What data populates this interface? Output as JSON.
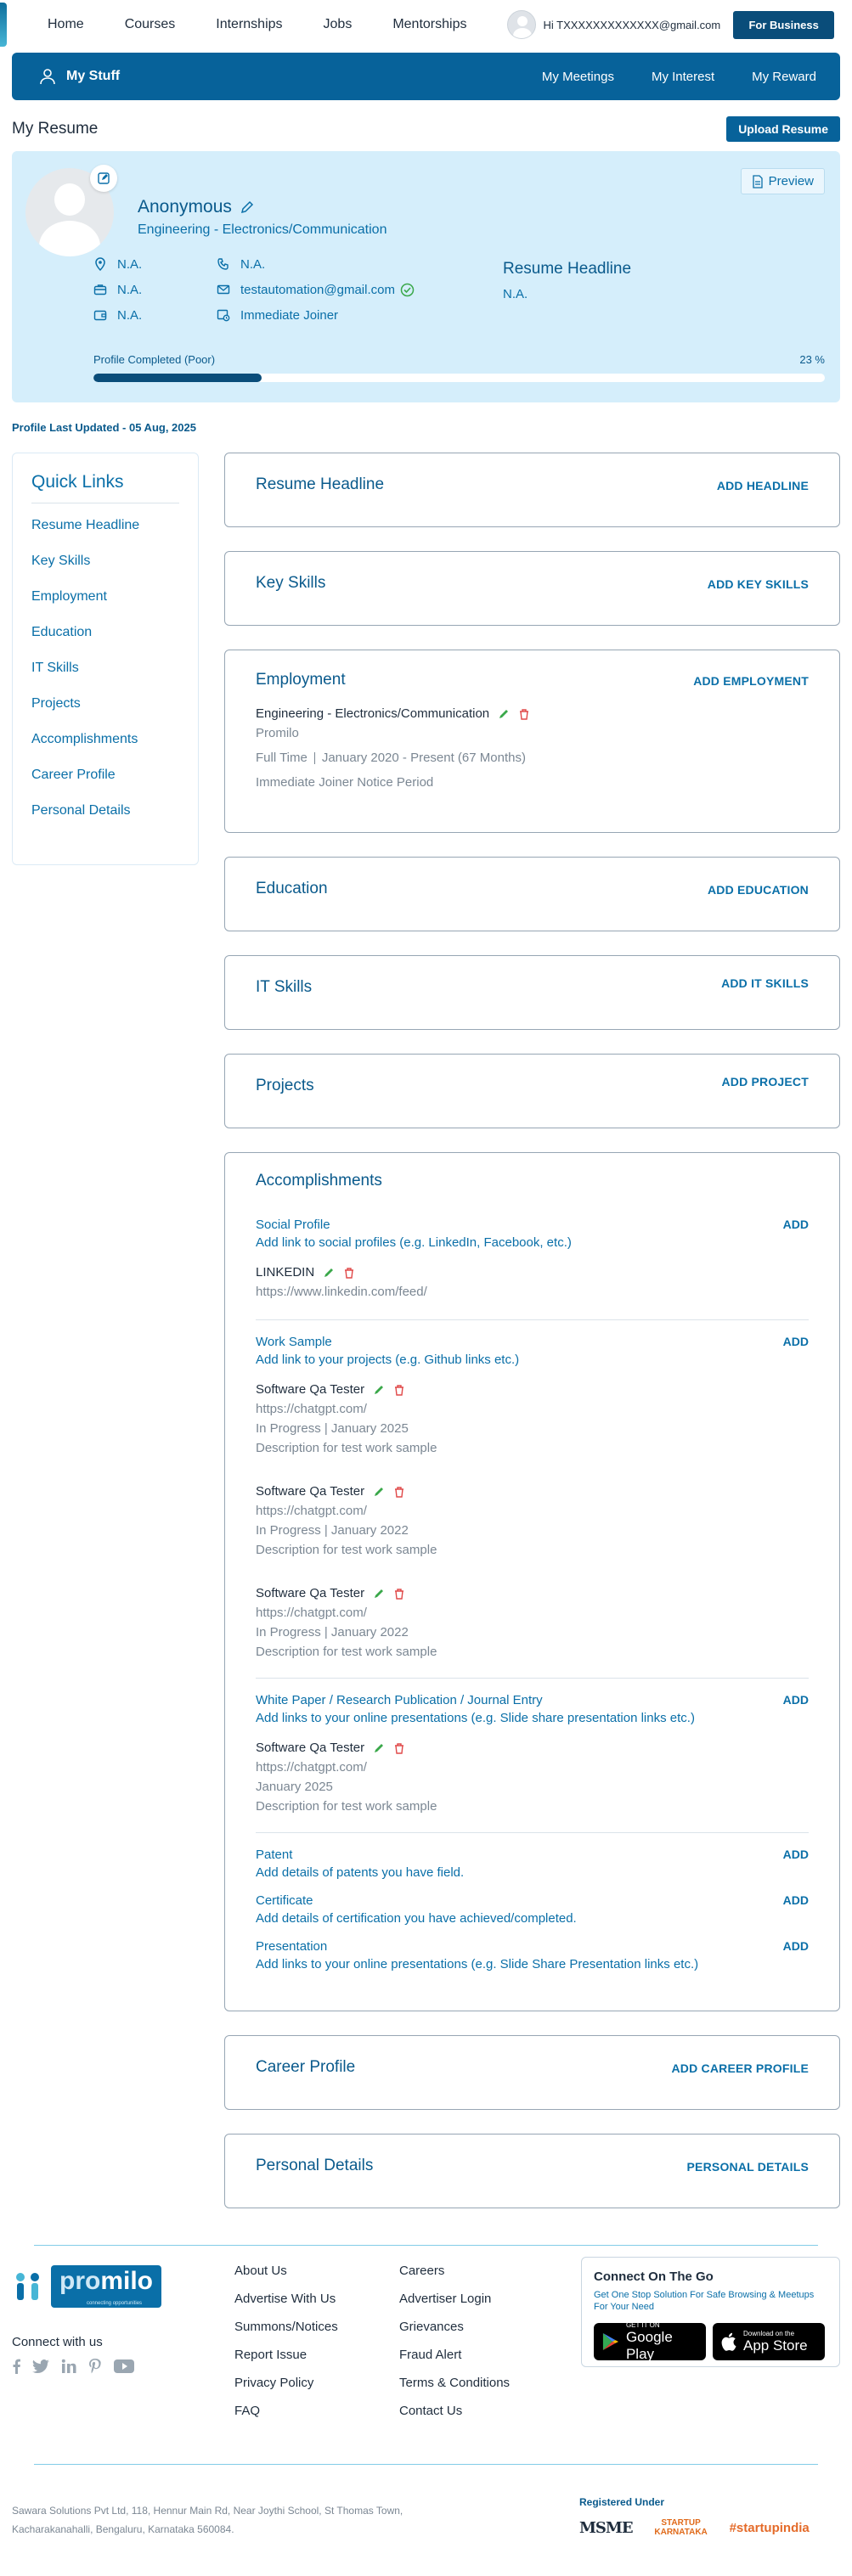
{
  "nav": {
    "links": [
      "Home",
      "Courses",
      "Internships",
      "Jobs",
      "Mentorships"
    ],
    "greeting": "Hi TXXXXXXXXXXXXX@gmail.com",
    "business_button": "For Business"
  },
  "mystuff": {
    "title": "My Stuff",
    "links": [
      "My Meetings",
      "My Interest",
      "My Reward"
    ]
  },
  "resume": {
    "heading": "My Resume",
    "upload_button": "Upload Resume"
  },
  "profile": {
    "name": "Anonymous",
    "subtitle": "Engineering - Electronics/Communication",
    "location": "N.A.",
    "phone": "N.A.",
    "experience": "N.A.",
    "email": "testautomation@gmail.com",
    "salary": "N.A.",
    "notice": "Immediate Joiner",
    "headline_title": "Resume Headline",
    "headline_value": "N.A.",
    "preview_label": "Preview",
    "progress_label": "Profile Completed (Poor)",
    "progress_text": "23 %",
    "progress_value": 0.23
  },
  "last_updated": "Profile Last Updated - 05 Aug, 2025",
  "quick_links": {
    "title": "Quick Links",
    "items": [
      "Resume Headline",
      "Key Skills",
      "Employment",
      "Education",
      "IT Skills",
      "Projects",
      "Accomplishments",
      "Career Profile",
      "Personal Details"
    ]
  },
  "sections": {
    "headline": {
      "title": "Resume Headline",
      "action": "ADD HEADLINE"
    },
    "key_skills": {
      "title": "Key Skills",
      "action": "ADD KEY SKILLS"
    },
    "employment": {
      "title": "Employment",
      "action": "ADD EMPLOYMENT",
      "entry": {
        "role": "Engineering - Electronics/Communication",
        "company": "Promilo",
        "type": "Full Time",
        "period": "January 2020 - Present (67 Months)",
        "notice": "Immediate Joiner Notice Period"
      }
    },
    "education": {
      "title": "Education",
      "action": "ADD EDUCATION"
    },
    "it_skills": {
      "title": "IT Skills",
      "action": "ADD IT SKILLS"
    },
    "projects": {
      "title": "Projects",
      "action": "ADD PROJECT"
    },
    "accomplishments": {
      "title": "Accomplishments",
      "add_label": "ADD",
      "social": {
        "title": "Social Profile",
        "desc": "Add link to social profiles (e.g. LinkedIn, Facebook, etc.)",
        "entry_title": "LINKEDIN",
        "entry_url": "https://www.linkedin.com/feed/"
      },
      "work": {
        "title": "Work Sample",
        "desc": "Add link to your projects (e.g. Github links etc.)",
        "entries": [
          {
            "title": "Software Qa Tester",
            "url": "https://chatgpt.com/",
            "status": "In Progress | January 2025",
            "desc": "Description for test work sample"
          },
          {
            "title": "Software Qa Tester",
            "url": "https://chatgpt.com/",
            "status": "In Progress | January 2022",
            "desc": "Description for test work sample"
          },
          {
            "title": "Software Qa Tester",
            "url": "https://chatgpt.com/",
            "status": "In Progress | January 2022",
            "desc": "Description for test work sample"
          }
        ]
      },
      "whitepaper": {
        "title": "White Paper / Research Publication / Journal Entry",
        "desc": "Add links to your online presentations (e.g. Slide share presentation links etc.)",
        "entry": {
          "title": "Software Qa Tester",
          "url": "https://chatgpt.com/",
          "status": "January 2025",
          "desc": "Description for test work sample"
        }
      },
      "patent": {
        "title": "Patent",
        "desc": "Add details of patents you have field."
      },
      "certificate": {
        "title": "Certificate",
        "desc": "Add details of certification you have achieved/completed."
      },
      "presentation": {
        "title": "Presentation",
        "desc": "Add links to your online presentations (e.g. Slide Share Presentation links etc.)"
      }
    },
    "career": {
      "title": "Career Profile",
      "action": "ADD CAREER PROFILE"
    },
    "personal": {
      "title": "Personal Details",
      "action": "PERSONAL DETAILS"
    }
  },
  "footer": {
    "logo_word": "milo",
    "logo_pro": "pro",
    "logo_tag": "connecting opportunities",
    "connect_with_us": "Connect with us",
    "col1": [
      "About Us",
      "Advertise With Us",
      "Summons/Notices",
      "Report Issue",
      "Privacy Policy",
      "FAQ"
    ],
    "col2": [
      "Careers",
      "Advertiser Login",
      "Grievances",
      "Fraud Alert",
      "Terms & Conditions",
      "Contact Us"
    ],
    "connect_title": "Connect On The Go",
    "connect_sub": "Get One Stop Solution For Safe Browsing & Meetups For Your Need",
    "google_small": "GET IT ON",
    "google_big": "Google Play",
    "apple_small": "Download on the",
    "apple_big": "App Store",
    "address": "Sawara Solutions Pvt Ltd, 118, Hennur Main Rd, Near Joythi School, St Thomas Town, Kacharakanahalli, Bengaluru, Karnataka 560084.",
    "registered": "Registered Under",
    "reg_logos": [
      "MSME",
      "STARTUP KARNATAKA",
      "#startupindia"
    ]
  },
  "colors": {
    "primary": "#07629a",
    "dark": "#0a4d7a",
    "profile_bg": "#d5eefb",
    "accent_link": "#0a6fa8",
    "delete": "#e04848",
    "ok": "#3aa84a"
  }
}
